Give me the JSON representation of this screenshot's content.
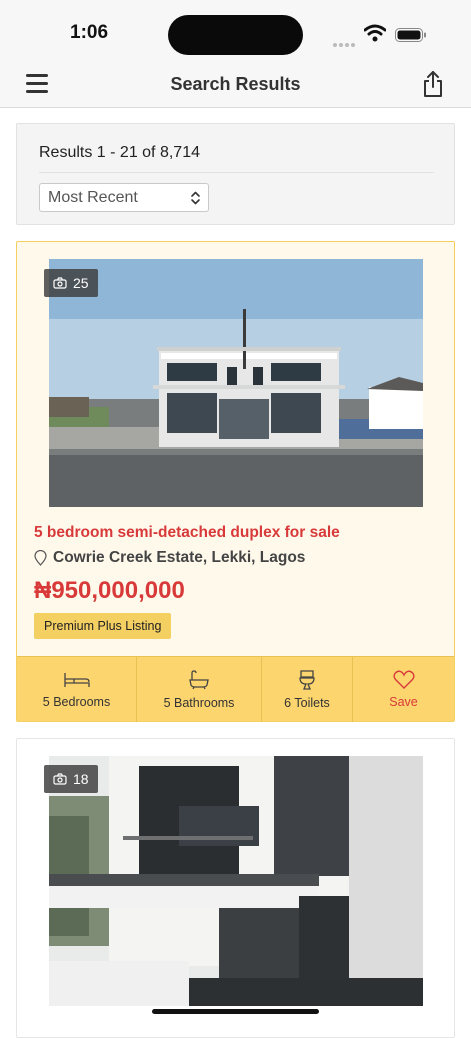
{
  "status": {
    "time": "1:06"
  },
  "nav": {
    "title": "Search Results"
  },
  "results": {
    "count_text": "Results 1 - 21 of 8,714",
    "sort_value": "Most Recent"
  },
  "listings": [
    {
      "photo_count": "25",
      "title": "5 bedroom semi-detached duplex for sale",
      "location": "Cowrie Creek Estate, Lekki, Lagos",
      "price": "₦950,000,000",
      "badge": "Premium Plus Listing",
      "features": {
        "bedrooms": "5 Bedrooms",
        "bathrooms": "5 Bathrooms",
        "toilets": "6 Toilets",
        "save": "Save"
      }
    },
    {
      "photo_count": "18"
    }
  ],
  "colors": {
    "accent_red": "#d83a3a",
    "premium_yellow": "#fcd56e",
    "card_cream": "#fff9ec"
  }
}
